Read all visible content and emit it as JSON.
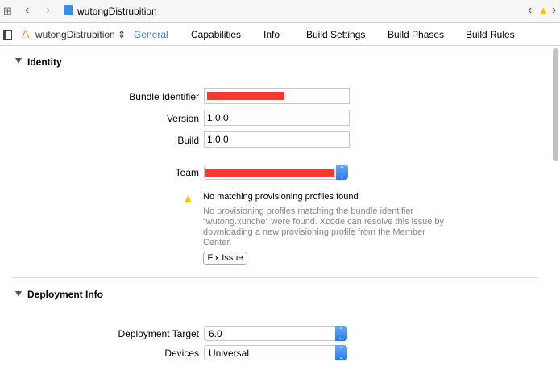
{
  "toolbar": {
    "file_name": "wutongDistrubition"
  },
  "tabbar": {
    "target": "wutongDistrubition",
    "tabs": [
      "General",
      "Capabilities",
      "Info",
      "Build Settings",
      "Build Phases",
      "Build Rules"
    ]
  },
  "identity": {
    "title": "Identity",
    "bundle_label": "Bundle Identifier",
    "version_label": "Version",
    "version": "1.0.0",
    "build_label": "Build",
    "build": "1.0.0",
    "team_label": "Team",
    "warning_title": "No matching provisioning profiles found",
    "warning_body": [
      "No provisioning profiles matching the bundle identifier",
      "“wutong.xunche” were found.  Xcode can resolve this issue by",
      "downloading a new provisioning profile from the Member",
      "Center."
    ],
    "fix_label": "Fix Issue"
  },
  "deployment": {
    "title": "Deployment Info",
    "target_label": "Deployment Target",
    "target": "6.0",
    "devices_label": "Devices",
    "devices": "Universal"
  },
  "colors": {
    "accent": "#3a7fd5",
    "redaction": "#f53a2f",
    "warning": "#f5c400"
  }
}
